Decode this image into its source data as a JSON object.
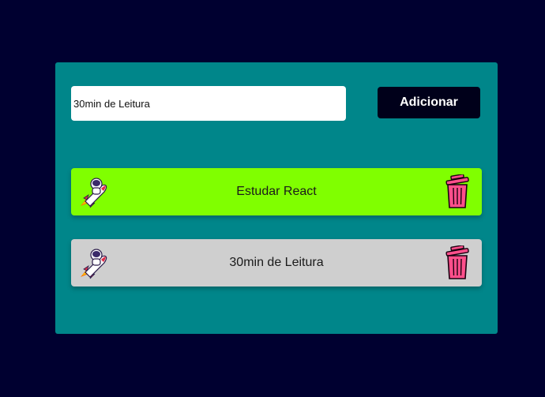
{
  "form": {
    "input_value": "30min de Leitura",
    "add_button_label": "Adicionar"
  },
  "tasks": [
    {
      "label": "Estudar React",
      "background": "#80ff00"
    },
    {
      "label": "30min de Leitura",
      "background": "#cfcfcf"
    }
  ],
  "colors": {
    "page_background": "#000030",
    "panel_background": "#00868a",
    "button_background": "#00001a",
    "trash_pink": "#ff4f8b"
  },
  "icons": {
    "task_icon": "rocket-astronaut-icon",
    "delete_icon": "trash-can-icon"
  }
}
